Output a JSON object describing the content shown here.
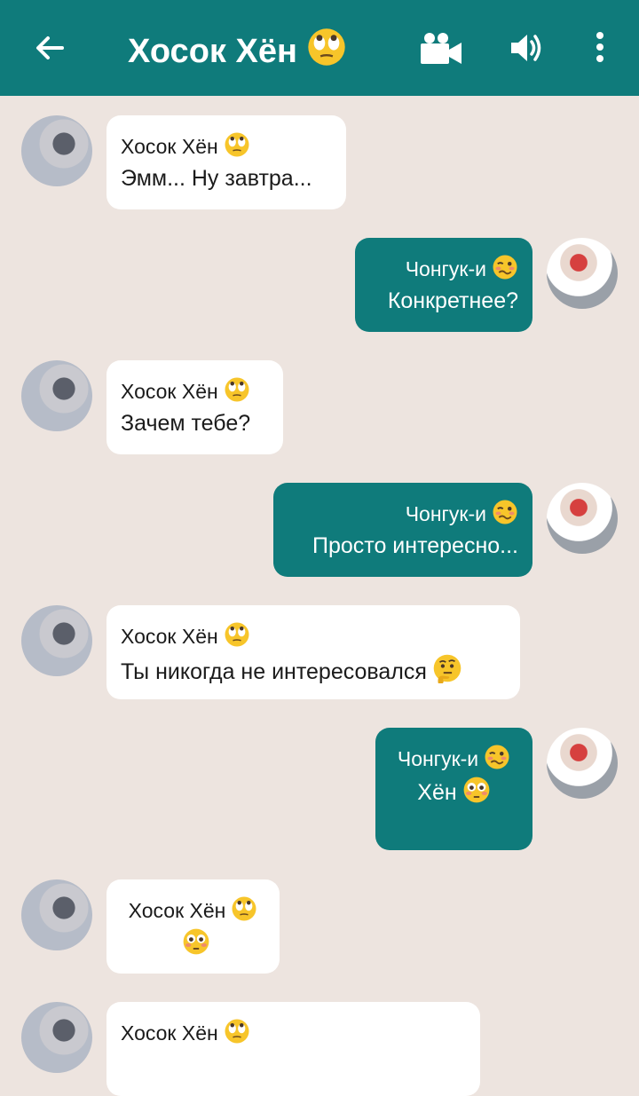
{
  "header": {
    "title": "Хосок Хён",
    "title_emoji": "eye-roll-emoji",
    "icons": [
      "back-arrow-icon",
      "video-camera-icon",
      "speaker-icon",
      "more-vert-icon"
    ],
    "colors": {
      "bar": "#0f7b7b",
      "background": "#ede4df"
    }
  },
  "messages": [
    {
      "side": "in",
      "name": "Хосок Хён",
      "name_emoji": "eye-roll-emoji",
      "text": "Эмм... Ну завтра..."
    },
    {
      "side": "out",
      "name": "Чонгук-и",
      "name_emoji": "woozy-emoji",
      "text": "Конкретнее?"
    },
    {
      "side": "in",
      "name": "Хосок Хён",
      "name_emoji": "eye-roll-emoji",
      "text": "Зачем тебе?"
    },
    {
      "side": "out",
      "name": "Чонгук-и",
      "name_emoji": "woozy-emoji",
      "text": "Просто интересно..."
    },
    {
      "side": "in",
      "name": "Хосок Хён",
      "name_emoji": "eye-roll-emoji",
      "text": "Ты никогда не интересовался",
      "text_emoji": "thinking-emoji"
    },
    {
      "side": "out",
      "name": "Чонгук-и",
      "name_emoji": "woozy-emoji",
      "text": "Хён",
      "text_emoji": "flushed-emoji"
    },
    {
      "side": "in",
      "name": "Хосок Хён",
      "name_emoji": "eye-roll-emoji",
      "text": "",
      "text_emoji": "flushed-emoji"
    },
    {
      "side": "in",
      "name": "Хосок Хён",
      "name_emoji": "eye-roll-emoji",
      "text": ""
    }
  ]
}
